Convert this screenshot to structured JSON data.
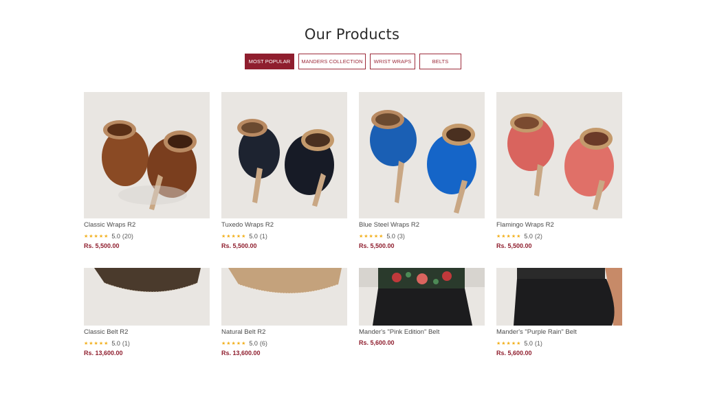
{
  "header": {
    "title": "Our Products"
  },
  "tabs": [
    {
      "label": "MOST POPULAR",
      "active": true
    },
    {
      "label": "MANDERS COLLECTION",
      "active": false
    },
    {
      "label": "WRIST WRAPS",
      "active": false
    },
    {
      "label": "BELTS",
      "active": false
    }
  ],
  "products": [
    {
      "name": "Classic Wraps R2",
      "stars": "★★★★★",
      "score": "5.0",
      "count": "(20)",
      "price": "Rs. 5,500.00",
      "image": "brown-leather-wrist-wraps",
      "color": "#8a4a24"
    },
    {
      "name": "Tuxedo Wraps R2",
      "stars": "★★★★★",
      "score": "5.0",
      "count": "(1)",
      "price": "Rs. 5,500.00",
      "image": "black-leather-wrist-wraps",
      "color": "#1d2330"
    },
    {
      "name": "Blue Steel Wraps R2",
      "stars": "★★★★★",
      "score": "5.0",
      "count": "(3)",
      "price": "Rs. 5,500.00",
      "image": "blue-leather-wrist-wraps",
      "color": "#1a5fb4"
    },
    {
      "name": "Flamingo Wraps R2",
      "stars": "★★★★★",
      "score": "5.0",
      "count": "(2)",
      "price": "Rs. 5,500.00",
      "image": "pink-leather-wrist-wraps",
      "color": "#d9645e"
    },
    {
      "name": "Classic Belt R2",
      "stars": "★★★★★",
      "score": "5.0",
      "count": "(1)",
      "price": "Rs. 13,600.00",
      "image": "dark-brown-leather-belt",
      "color": "#4a3a2c"
    },
    {
      "name": "Natural Belt R2",
      "stars": "★★★★★",
      "score": "5.0",
      "count": "(6)",
      "price": "Rs. 13,600.00",
      "image": "natural-tan-leather-belt",
      "color": "#c4a27c"
    },
    {
      "name": "Mander's \"Pink Edition\" Belt",
      "stars": "",
      "score": "",
      "count": "",
      "price": "Rs. 5,600.00",
      "image": "floral-waist-belt-on-model",
      "color": "#1c1c1e"
    },
    {
      "name": "Mander's \"Purple Rain\" Belt",
      "stars": "★★★★★",
      "score": "5.0",
      "count": "(1)",
      "price": "Rs. 5,600.00",
      "image": "purple-waist-belt-on-model",
      "color": "#1c1c1e"
    }
  ]
}
